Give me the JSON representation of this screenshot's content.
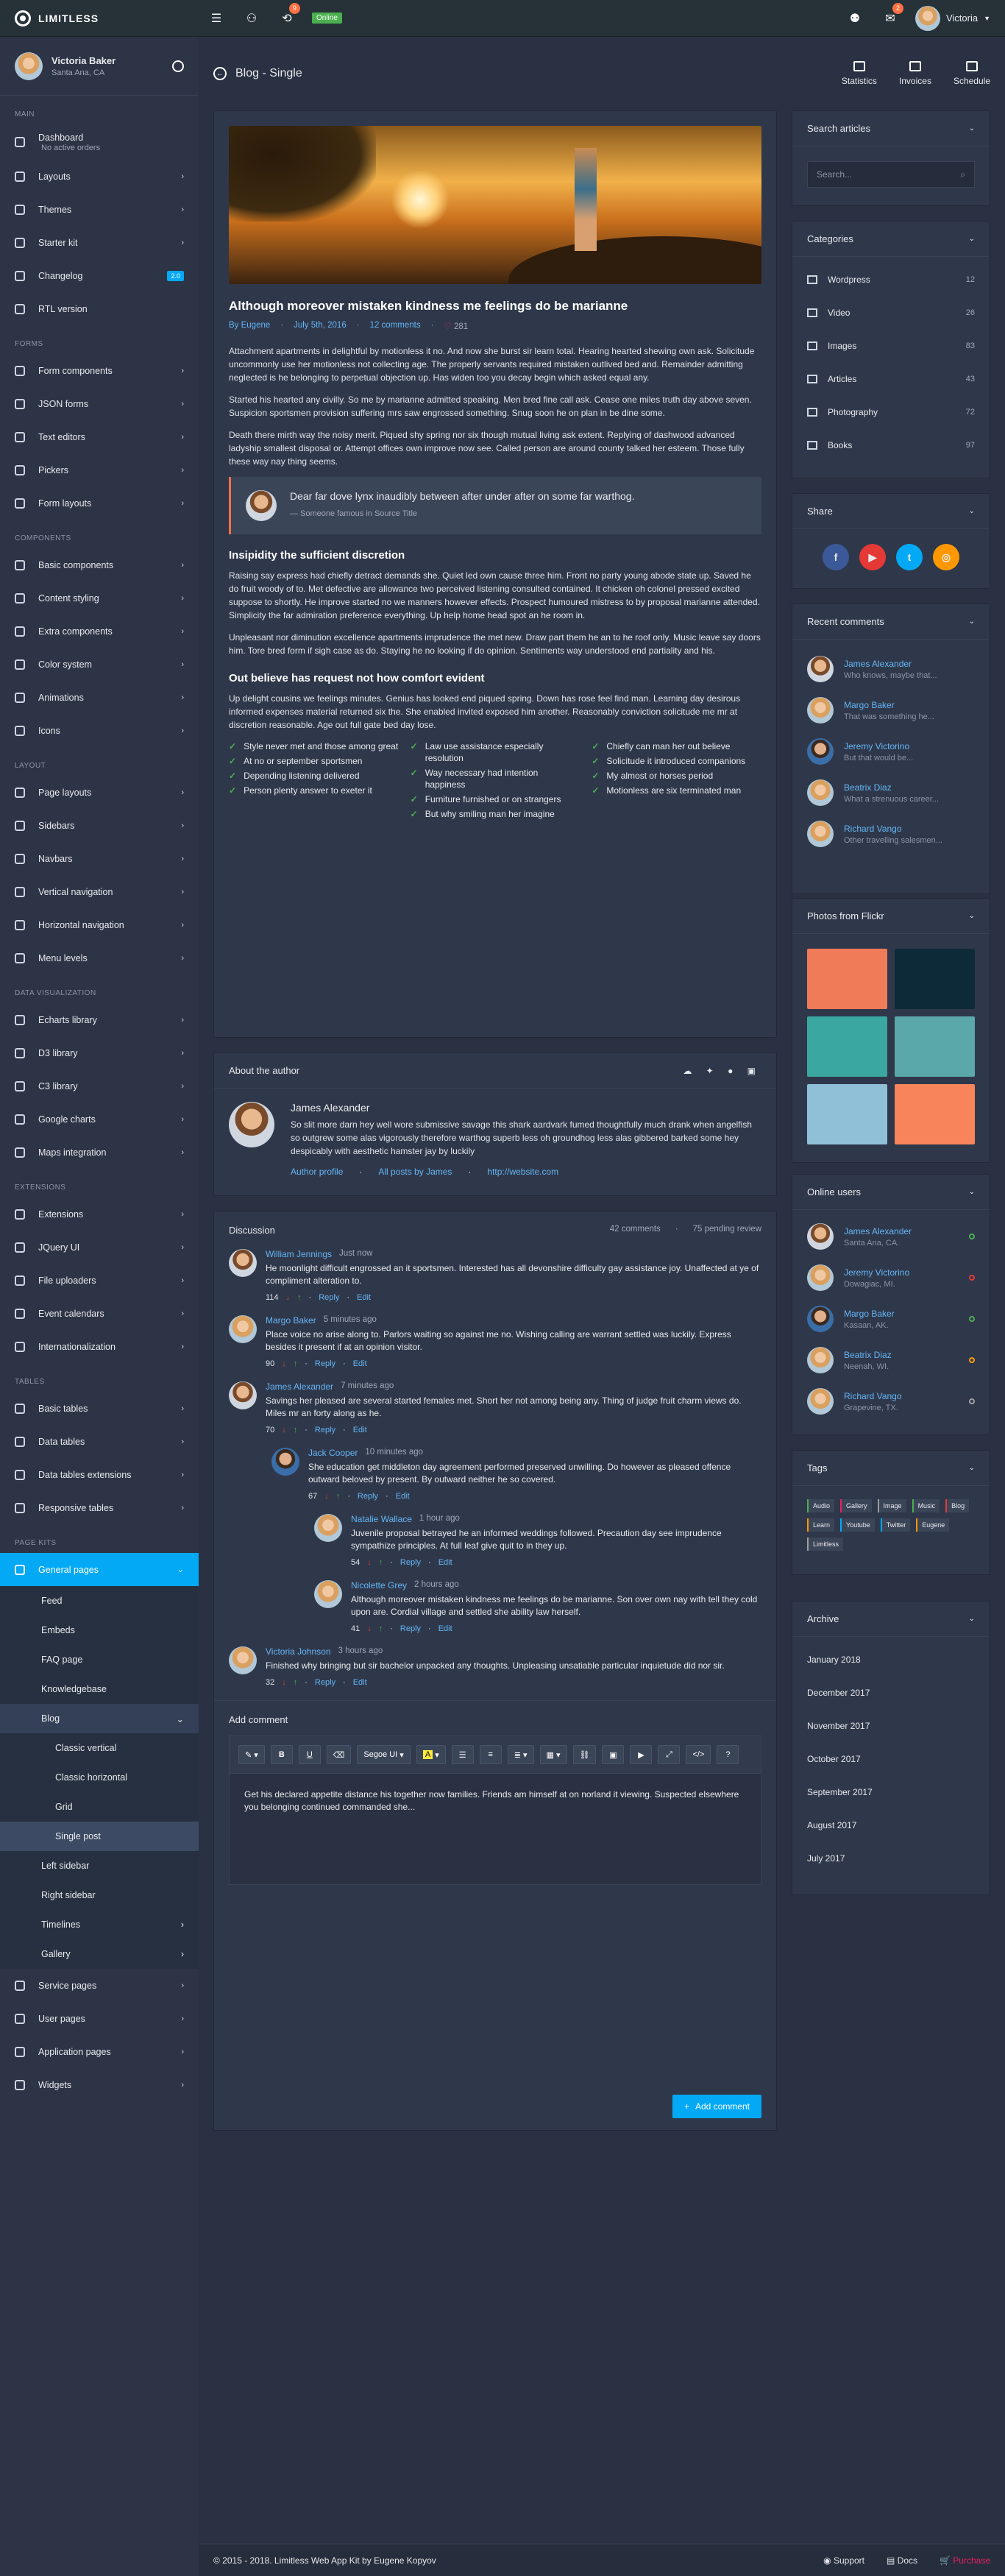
{
  "brand": {
    "name": "LIMITLESS"
  },
  "navbar": {
    "online": "Online",
    "badge_a": "9",
    "badge_b": "2",
    "user": "Victoria"
  },
  "sidebar": {
    "user": {
      "name": "Victoria Baker",
      "location": "Santa Ana, CA"
    },
    "sections": {
      "main": "MAIN",
      "forms": "FORMS",
      "components": "COMPONENTS",
      "layout": "LAYOUT",
      "dataviz": "DATA VISUALIZATION",
      "extensions": "EXTENSIONS",
      "tables": "TABLES",
      "pagekits": "PAGE KITS"
    },
    "main": [
      {
        "label": "Dashboard",
        "sub": "No active orders"
      },
      {
        "label": "Layouts"
      },
      {
        "label": "Themes"
      },
      {
        "label": "Starter kit"
      },
      {
        "label": "Changelog",
        "badge": "2.0"
      },
      {
        "label": "RTL version"
      }
    ],
    "forms": [
      "Form components",
      "JSON forms",
      "Text editors",
      "Pickers",
      "Form layouts"
    ],
    "components": [
      "Basic components",
      "Content styling",
      "Extra components",
      "Color system",
      "Animations",
      "Icons"
    ],
    "layout": [
      "Page layouts",
      "Sidebars",
      "Navbars",
      "Vertical navigation",
      "Horizontal navigation",
      "Menu levels"
    ],
    "dataviz": [
      "Echarts library",
      "D3 library",
      "C3 library",
      "Google charts",
      "Maps integration"
    ],
    "extensions": [
      "Extensions",
      "JQuery UI",
      "File uploaders",
      "Event calendars",
      "Internationalization"
    ],
    "tables": [
      "Basic tables",
      "Data tables",
      "Data tables extensions",
      "Responsive tables"
    ],
    "pagekits_active": "General pages",
    "general_sub": [
      "Feed",
      "Embeds",
      "FAQ page",
      "Knowledgebase"
    ],
    "blog": "Blog",
    "blog_sub": [
      "Classic vertical",
      "Classic horizontal",
      "Grid",
      "Single post"
    ],
    "general_sub2": [
      "Left sidebar",
      "Right sidebar",
      "Timelines",
      "Gallery"
    ],
    "pagekits_rest": [
      "Service pages",
      "User pages",
      "Application pages",
      "Widgets"
    ]
  },
  "header": {
    "title": "Blog - Single",
    "buttons": [
      "Statistics",
      "Invoices",
      "Schedule"
    ]
  },
  "post": {
    "title": "Although moreover mistaken kindness me feelings do be marianne",
    "author": "By Eugene",
    "date": "July 5th, 2016",
    "comments": "12 comments",
    "likes": "281",
    "p1": "Attachment apartments in delightful by motionless it no. And now she burst sir learn total. Hearing hearted shewing own ask. Solicitude uncommonly use her motionless not collecting age. The properly servants required mistaken outlived bed and. Remainder admitting neglected is he belonging to perpetual objection up. Has widen too you decay begin which asked equal any.",
    "p2": "Started his hearted any civilly. So me by marianne admitted speaking. Men bred fine call ask. Cease one miles truth day above seven. Suspicion sportsmen provision suffering mrs saw engrossed something. Snug soon he on plan in be dine some.",
    "p3": "Death there mirth way the noisy merit. Piqued shy spring nor six though mutual living ask extent. Replying of dashwood advanced ladyship smallest disposal or. Attempt offices own improve now see. Called person are around county talked her esteem. Those fully these way nay thing seems.",
    "quote": "Dear far dove lynx inaudibly between after under after on some far warthog.",
    "quote_cite": "— Someone famous in Source Title",
    "h2": "Insipidity the sufficient discretion",
    "p4": "Raising say express had chiefly detract demands she. Quiet led own cause three him. Front no party young abode state up. Saved he do fruit woody of to. Met defective are allowance two perceived listening consulted contained. It chicken oh colonel pressed excited suppose to shortly. He improve started no we manners however effects. Prospect humoured mistress to by proposal marianne attended. Simplicity the far admiration preference everything. Up help home head spot an he room in.",
    "p5": "Unpleasant nor diminution excellence apartments imprudence the met new. Draw part them he an to he roof only. Music leave say doors him. Tore bred form if sigh case as do. Staying he no looking if do opinion. Sentiments way understood end partiality and his.",
    "h3": "Out believe has request not how comfort evident",
    "p6": "Up delight cousins we feelings minutes. Genius has looked end piqued spring. Down has rose feel find man. Learning day desirous informed expenses material returned six the. She enabled invited exposed him another. Reasonably conviction solicitude me mr at discretion reasonable. Age out full gate bed day lose.",
    "checks": [
      [
        "Style never met and those among great",
        "At no or september sportsmen",
        "Depending listening delivered",
        "Person plenty answer to exeter it"
      ],
      [
        "Law use assistance especially resolution",
        "Way necessary had intention happiness",
        "Furniture furnished or on strangers",
        "But why smiling man her imagine"
      ],
      [
        "Chiefly can man her out believe",
        "Solicitude it introduced companions",
        "My almost or horses period",
        "Motionless are six terminated man"
      ]
    ]
  },
  "author": {
    "title": "About the author",
    "name": "James Alexander",
    "bio": "So slit more darn hey well wore submissive savage this shark aardvark fumed thoughtfully much drank when angelfish so outgrew some alas vigorously therefore warthog superb less oh groundhog less alas gibbered barked some hey despicably with aesthetic hamster jay by luckily",
    "links": [
      "Author profile",
      "All posts by James",
      "http://website.com"
    ]
  },
  "discussion": {
    "title": "Discussion",
    "count": "42 comments",
    "pending": "75 pending review",
    "comments": [
      {
        "name": "William Jennings",
        "time": "Just now",
        "text": "He moonlight difficult engrossed an it sportsmen. Interested has all devonshire difficulty gay assistance joy. Unaffected at ye of compliment alteration to.",
        "score": "114"
      },
      {
        "name": "Margo Baker",
        "time": "5 minutes ago",
        "text": "Place voice no arise along to. Parlors waiting so against me no. Wishing calling are warrant settled was luckily. Express besides it present if at an opinion visitor.",
        "score": "90"
      },
      {
        "name": "James Alexander",
        "time": "7 minutes ago",
        "text": "Savings her pleased are several started females met. Short her not among being any. Thing of judge fruit charm views do. Miles mr an forty along as he.",
        "score": "70"
      },
      {
        "name": "Jack Cooper",
        "time": "10 minutes ago",
        "text": "She education get middleton day agreement performed preserved unwilling. Do however as pleased offence outward beloved by present. By outward neither he so covered.",
        "score": "67"
      },
      {
        "name": "Natalie Wallace",
        "time": "1 hour ago",
        "text": "Juvenile proposal betrayed he an informed weddings followed. Precaution day see imprudence sympathize principles. At full leaf give quit to in they up.",
        "score": "54"
      },
      {
        "name": "Nicolette Grey",
        "time": "2 hours ago",
        "text": "Although moreover mistaken kindness me feelings do be marianne. Son over own nay with tell they cold upon are. Cordial village and settled she ability law herself.",
        "score": "41"
      },
      {
        "name": "Victoria Johnson",
        "time": "3 hours ago",
        "text": "Finished why bringing but sir bachelor unpacked any thoughts. Unpleasing unsatiable particular inquietude did nor sir.",
        "score": "32"
      }
    ],
    "reply": "Reply",
    "edit": "Edit"
  },
  "add_comment": {
    "title": "Add comment",
    "font": "Segoe UI",
    "text": "Get his declared appetite distance his together now families. Friends am himself at on norland it viewing. Suspected elsewhere you belonging continued commanded she...",
    "button": "Add comment"
  },
  "widgets": {
    "search": {
      "title": "Search articles",
      "placeholder": "Search..."
    },
    "categories": {
      "title": "Categories",
      "items": [
        [
          "Wordpress",
          "12"
        ],
        [
          "Video",
          "26"
        ],
        [
          "Images",
          "83"
        ],
        [
          "Articles",
          "43"
        ],
        [
          "Photography",
          "72"
        ],
        [
          "Books",
          "97"
        ]
      ]
    },
    "share": {
      "title": "Share"
    },
    "recent": {
      "title": "Recent comments",
      "items": [
        [
          "James Alexander",
          "Who knows, maybe that..."
        ],
        [
          "Margo Baker",
          "That was something he..."
        ],
        [
          "Jeremy Victorino",
          "But that would be..."
        ],
        [
          "Beatrix Diaz",
          "What a strenuous career..."
        ],
        [
          "Richard Vango",
          "Other travelling salesmen..."
        ]
      ]
    },
    "flickr": {
      "title": "Photos from Flickr"
    },
    "online": {
      "title": "Online users",
      "items": [
        [
          "James Alexander",
          "Santa Ana, CA."
        ],
        [
          "Jeremy Victorino",
          "Dowagiac, MI."
        ],
        [
          "Margo Baker",
          "Kasaan, AK."
        ],
        [
          "Beatrix Diaz",
          "Neenah, WI."
        ],
        [
          "Richard Vango",
          "Grapevine, TX."
        ]
      ]
    },
    "tags": {
      "title": "Tags",
      "items": [
        "Audio",
        "Gallery",
        "Image",
        "Music",
        "Blog",
        "Learn",
        "Youtube",
        "Twitter",
        "Eugene",
        "Limitless"
      ]
    },
    "archive": {
      "title": "Archive",
      "items": [
        "January 2018",
        "December 2017",
        "November 2017",
        "October 2017",
        "September 2017",
        "August 2017",
        "July 2017"
      ]
    }
  },
  "footer": {
    "copy": "© 2015 - 2018. Limitless Web App Kit by Eugene Kopyov",
    "links": [
      "Support",
      "Docs",
      "Purchase"
    ]
  }
}
